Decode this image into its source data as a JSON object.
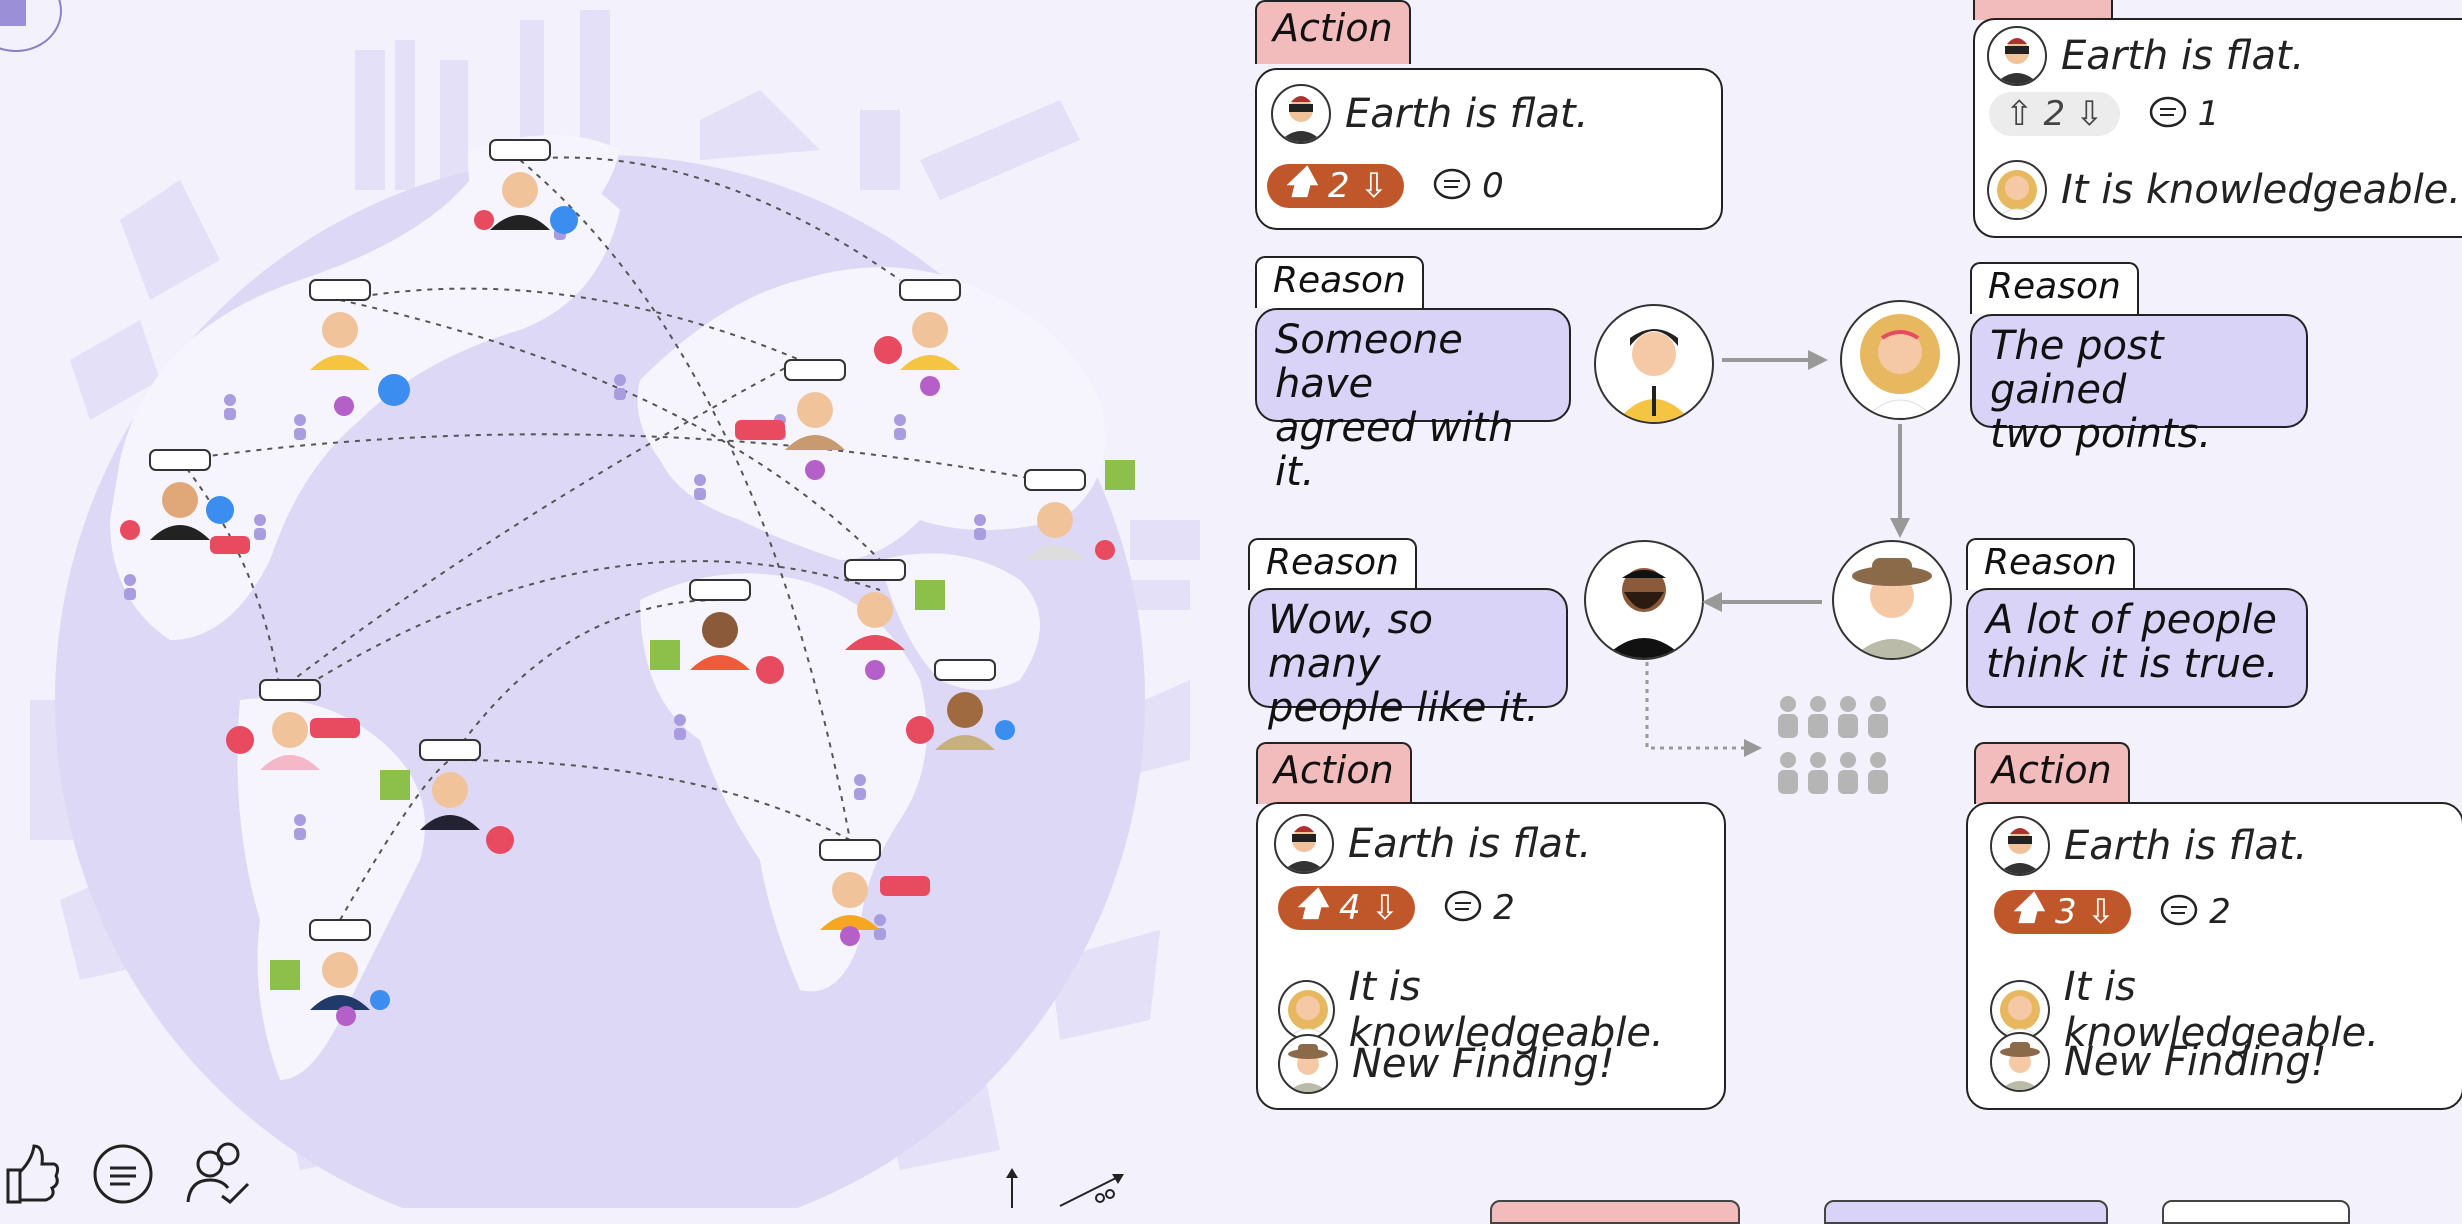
{
  "colors": {
    "action_tag": "#f2bcbc",
    "reason_bubble": "#d9d4f7",
    "upvote_active": "#c0572a",
    "globe": "#ddd8f5",
    "land": "#f6f5fd",
    "accent_purple": "#9b8fd8"
  },
  "panel_top_left": {
    "tag": "Action",
    "post": "Earth is flat.",
    "votes": "2",
    "comments": "0"
  },
  "panel_top_right": {
    "post": "Earth is flat.",
    "votes": "2",
    "comments": "1",
    "reply": "It is knowledgeable."
  },
  "reasons": [
    {
      "tag": "Reason",
      "text_line1": "Someone have",
      "text_line2": "agreed with it."
    },
    {
      "tag": "Reason",
      "text_line1": "The post gained",
      "text_line2": "two points."
    },
    {
      "tag": "Reason",
      "text_line1": "Wow, so many",
      "text_line2": "people like it."
    },
    {
      "tag": "Reason",
      "text_line1": "A lot of people",
      "text_line2": "think it is true."
    }
  ],
  "panel_bottom_left": {
    "tag": "Action",
    "post": "Earth is flat.",
    "votes": "4",
    "comments": "2",
    "reply1": "It is knowledgeable.",
    "reply2": "New Finding!"
  },
  "panel_bottom_right": {
    "tag": "Action",
    "post": "Earth is flat.",
    "votes": "3",
    "comments": "2",
    "reply1": "It is knowledgeable.",
    "reply2": "New Finding!"
  },
  "icons": {
    "like": "thumbs-up-icon",
    "comment": "comment-icon",
    "follow": "user-check-icon",
    "trend": "trend-arrow-icon"
  }
}
